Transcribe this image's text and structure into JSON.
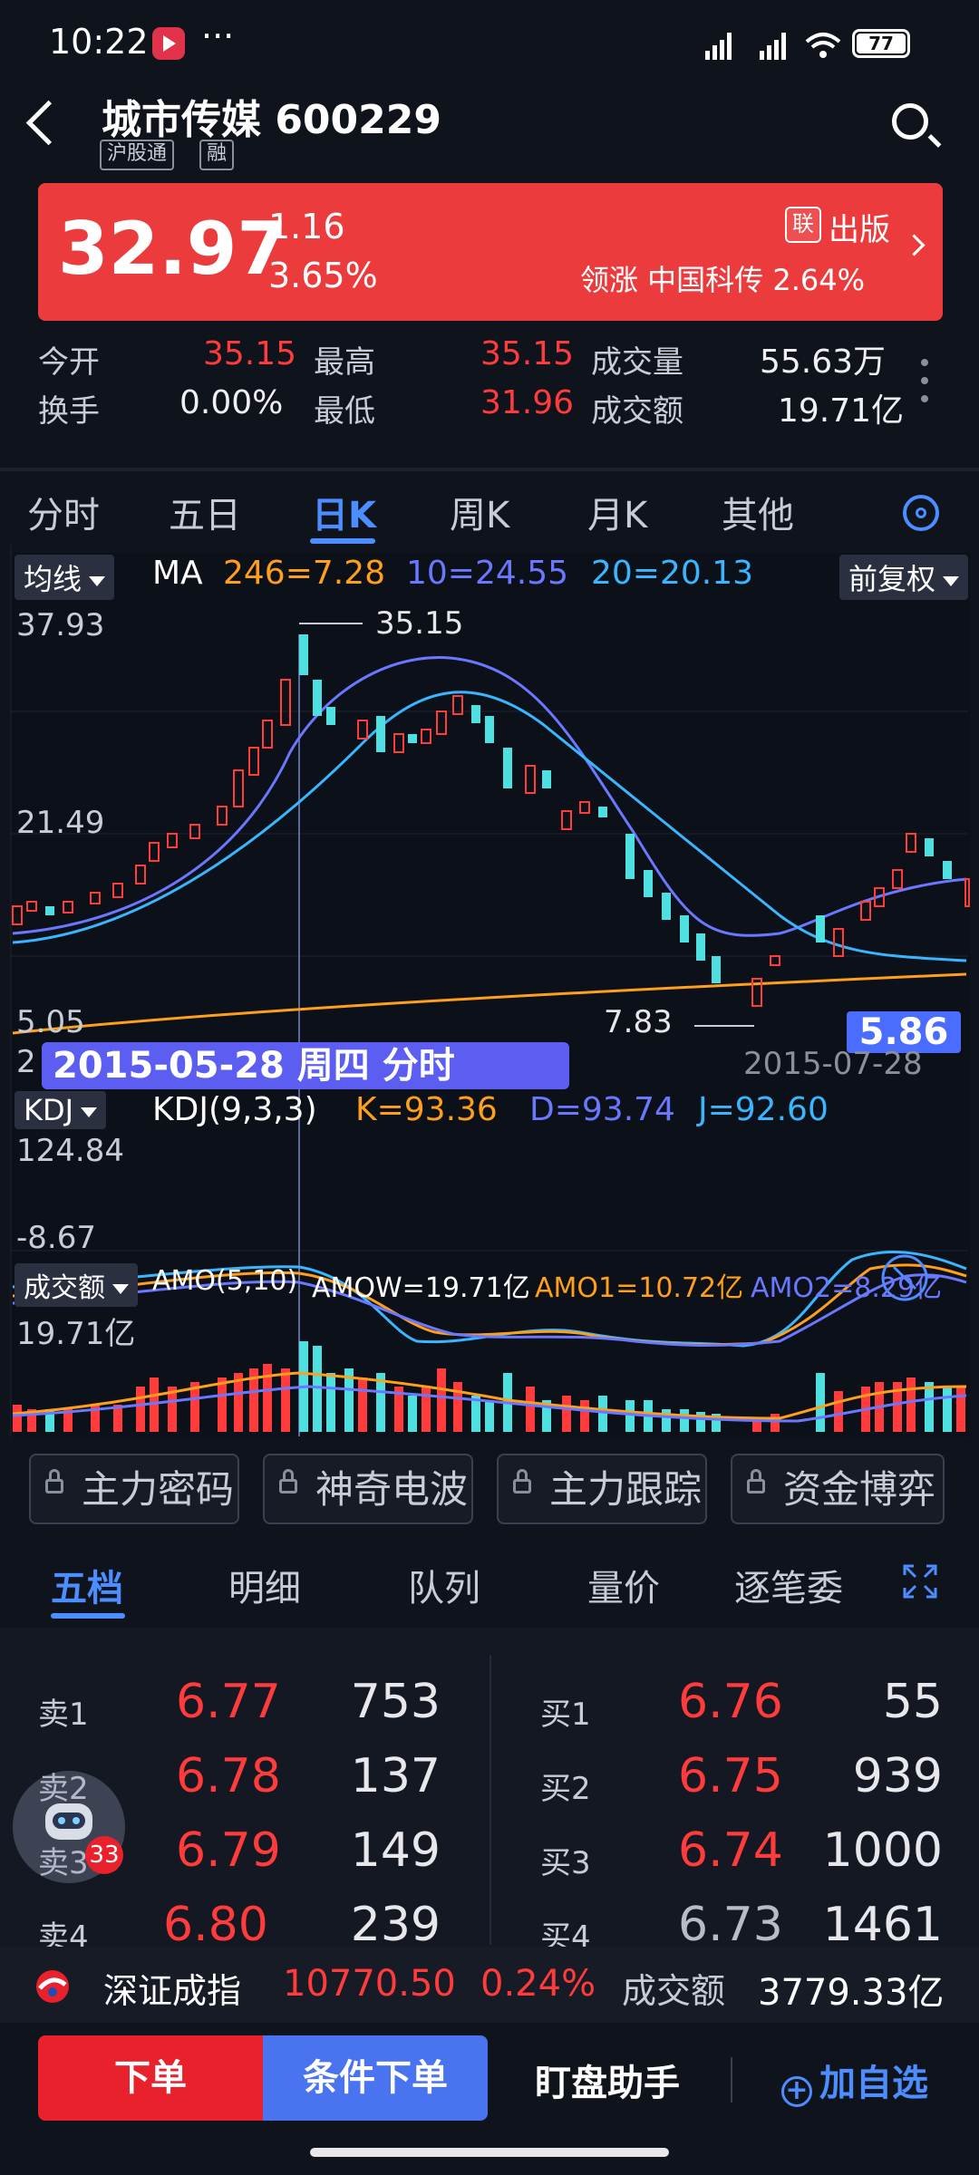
{
  "status_bar": {
    "time": "10:22",
    "battery": "77",
    "dots": "···"
  },
  "header": {
    "stock_title": "城市传媒 600229",
    "tags": [
      "沪股通",
      "融"
    ]
  },
  "quote": {
    "price": "32.97",
    "change": "1.16",
    "change_pct": "3.65%",
    "lian_badge": "联",
    "sector_label": "出版",
    "leader_text": "领涨  中国科传  2.64%"
  },
  "stats": {
    "row1": [
      {
        "label": "今开",
        "value": "35.15"
      },
      {
        "label": "最高",
        "value": "35.15"
      },
      {
        "label": "成交量",
        "value": "55.63万"
      }
    ],
    "row2": [
      {
        "label": "换手",
        "value": "0.00%"
      },
      {
        "label": "最低",
        "value": "31.96"
      },
      {
        "label": "成交额",
        "value": "19.71亿"
      }
    ]
  },
  "chart_tabs": [
    "分时",
    "五日",
    "日K",
    "周K",
    "月K",
    "其他"
  ],
  "active_chart_tab": "日K",
  "kline": {
    "indicator_dropdown": "均线",
    "ma_prefix": "MA",
    "ma_values": [
      {
        "text": "246=7.28",
        "color": "#ff9f1a"
      },
      {
        "text": "10=24.55",
        "color": "#6a78ff"
      },
      {
        "text": "20=20.13",
        "color": "#38b6ff"
      }
    ],
    "adjust_dropdown": "前复权",
    "axis_top": "37.93",
    "axis_mid": "21.49",
    "axis_bottom": "5.05",
    "high_label": "35.15",
    "low_label": "7.83",
    "current_tag": "5.86",
    "selected_date": "2015-05-28 周四 分时",
    "end_date": "2015-07-28",
    "axis_fragment": "2"
  },
  "kdj": {
    "dropdown": "KDJ",
    "params": "KDJ(9,3,3)",
    "k": "K=93.36",
    "d": "D=93.74",
    "j": "J=92.60",
    "axis_top": "124.84",
    "axis_bottom": "-8.67",
    "colors": {
      "k": "#ff9f1a",
      "d": "#6a78ff",
      "j": "#38b6ff"
    }
  },
  "amount": {
    "dropdown": "成交额",
    "params": "AMO(5,10)",
    "amow": "AMOW=19.71亿",
    "amo1": "AMO1=10.72亿",
    "amo2": "AMO2=8.29亿",
    "axis_top": "19.71亿"
  },
  "tool_buttons": [
    "主力密码",
    "神奇电波",
    "主力跟踪",
    "资金博弈"
  ],
  "order_tabs": [
    "五档",
    "明细",
    "队列",
    "量价",
    "逐笔委"
  ],
  "order_book": {
    "asks": [
      {
        "label": "卖1",
        "price": "6.77",
        "qty": "753"
      },
      {
        "label": "卖2",
        "price": "6.78",
        "qty": "137"
      },
      {
        "label": "卖3",
        "price": "6.79",
        "qty": "149"
      },
      {
        "label": "卖4",
        "price": "6.80",
        "qty": "239"
      }
    ],
    "bids": [
      {
        "label": "买1",
        "price": "6.76",
        "qty": "55"
      },
      {
        "label": "买2",
        "price": "6.75",
        "qty": "939"
      },
      {
        "label": "买3",
        "price": "6.74",
        "qty": "1000"
      },
      {
        "label": "买4",
        "price": "6.73",
        "qty": "1461"
      }
    ]
  },
  "assistant_badge": "33",
  "index_ticker": {
    "name": "深证成指",
    "value": "10770.50",
    "pct": "0.24%",
    "amount_label": "成交额",
    "amount": "3779.33亿"
  },
  "bottom_actions": {
    "order": "下单",
    "conditional": "条件下单",
    "assistant": "盯盘助手",
    "watchlist": "加自选"
  }
}
